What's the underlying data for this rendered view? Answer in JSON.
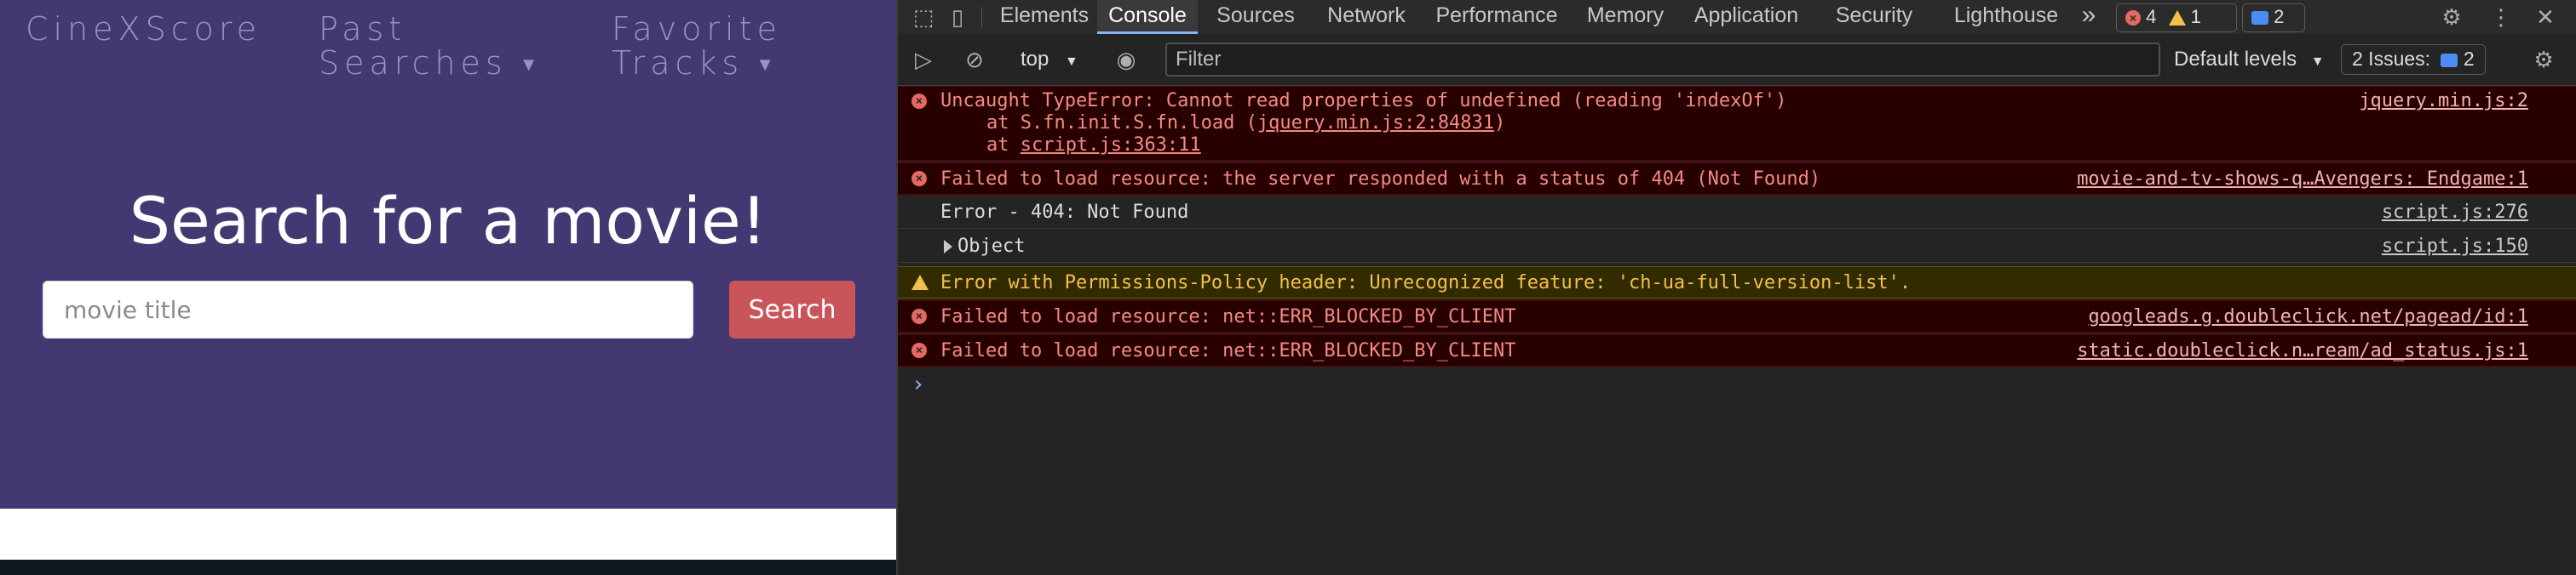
{
  "site": {
    "brand": "CineXScore",
    "nav": [
      {
        "label_line1": "Past",
        "label_line2": "Searches"
      },
      {
        "label_line1": "Favorite",
        "label_line2": "Tracks"
      }
    ],
    "hero_title": "Search for a movie!",
    "search": {
      "placeholder": "movie title",
      "value": "",
      "button_label": "Search"
    },
    "colors": {
      "background": "#443872",
      "button": "#c9555a"
    }
  },
  "devtools": {
    "tabs": [
      "Elements",
      "Console",
      "Sources",
      "Network",
      "Performance",
      "Memory",
      "Application",
      "Security",
      "Lighthouse"
    ],
    "active_tab": "Console",
    "more_tabs_glyph": "»",
    "counts": {
      "errors": "4",
      "warnings": "1",
      "messages": "2"
    },
    "toolbar": {
      "context": "top",
      "filter_placeholder": "Filter",
      "levels": "Default levels",
      "issues_label": "2 Issues:",
      "issues_count": "2"
    },
    "messages": [
      {
        "level": "error",
        "text": "Uncaught TypeError: Cannot read properties of undefined (reading 'indexOf')",
        "trace1_prefix": "at S.fn.init.S.fn.load (",
        "trace1_link": "jquery.min.js:2:84831",
        "trace1_suffix": ")",
        "trace2_prefix": "at ",
        "trace2_link": "script.js:363:11",
        "source": "jquery.min.js:2"
      },
      {
        "level": "error",
        "text": "Failed to load resource: the server responded with a status of 404 (Not Found)",
        "source": "movie-and-tv-shows-q…Avengers: Endgame:1"
      },
      {
        "level": "info",
        "text": "Error - 404: Not Found",
        "source": "script.js:276"
      },
      {
        "level": "info",
        "text": "Object",
        "source": "script.js:150"
      },
      {
        "level": "warning",
        "text": "Error with Permissions-Policy header: Unrecognized feature: 'ch-ua-full-version-list'.",
        "source": ""
      },
      {
        "level": "error",
        "text": "Failed to load resource: net::ERR_BLOCKED_BY_CLIENT",
        "source": "googleads.g.doubleclick.net/pagead/id:1"
      },
      {
        "level": "error",
        "text": "Failed to load resource: net::ERR_BLOCKED_BY_CLIENT",
        "source": "static.doubleclick.n…ream/ad_status.js:1"
      }
    ],
    "prompt_glyph": "›"
  }
}
